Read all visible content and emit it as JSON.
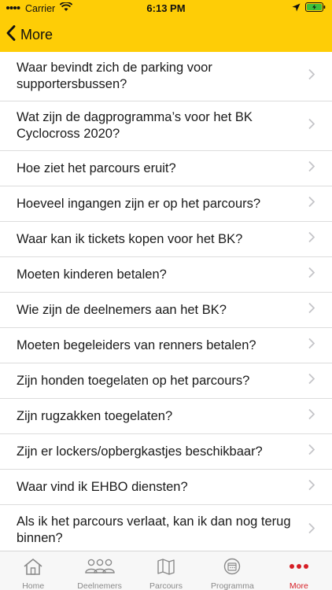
{
  "status": {
    "carrier": "Carrier",
    "time": "6:13 PM"
  },
  "nav": {
    "back_label": "More"
  },
  "faq": [
    {
      "text": "Waar bevindt zich de parking voor supportersbussen?"
    },
    {
      "text": "Wat zijn de dagprogramma’s voor het BK Cyclocross 2020?"
    },
    {
      "text": "Hoe ziet het parcours eruit?"
    },
    {
      "text": "Hoeveel ingangen zijn er op het parcours?"
    },
    {
      "text": "Waar kan ik tickets kopen voor het BK?"
    },
    {
      "text": "Moeten kinderen betalen?"
    },
    {
      "text": "Wie zijn de deelnemers aan het BK?"
    },
    {
      "text": "Moeten begeleiders van renners betalen?"
    },
    {
      "text": "Zijn honden toegelaten op het parcours?"
    },
    {
      "text": "Zijn rugzakken toegelaten?"
    },
    {
      "text": "Zijn er lockers/opbergkastjes beschikbaar?"
    },
    {
      "text": "Waar vind ik EHBO diensten?"
    },
    {
      "text": "Als ik het parcours verlaat, kan ik dan nog terug binnen?"
    }
  ],
  "tabs": [
    {
      "label": "Home",
      "icon": "home-icon"
    },
    {
      "label": "Deelnemers",
      "icon": "people-icon"
    },
    {
      "label": "Parcours",
      "icon": "map-icon"
    },
    {
      "label": "Programma",
      "icon": "calendar-icon"
    },
    {
      "label": "More",
      "icon": "more-dots-icon",
      "active": true
    }
  ],
  "colors": {
    "header": "#fecd06",
    "active_tab": "#d61f26",
    "inactive_tab": "#8a8a8a"
  }
}
